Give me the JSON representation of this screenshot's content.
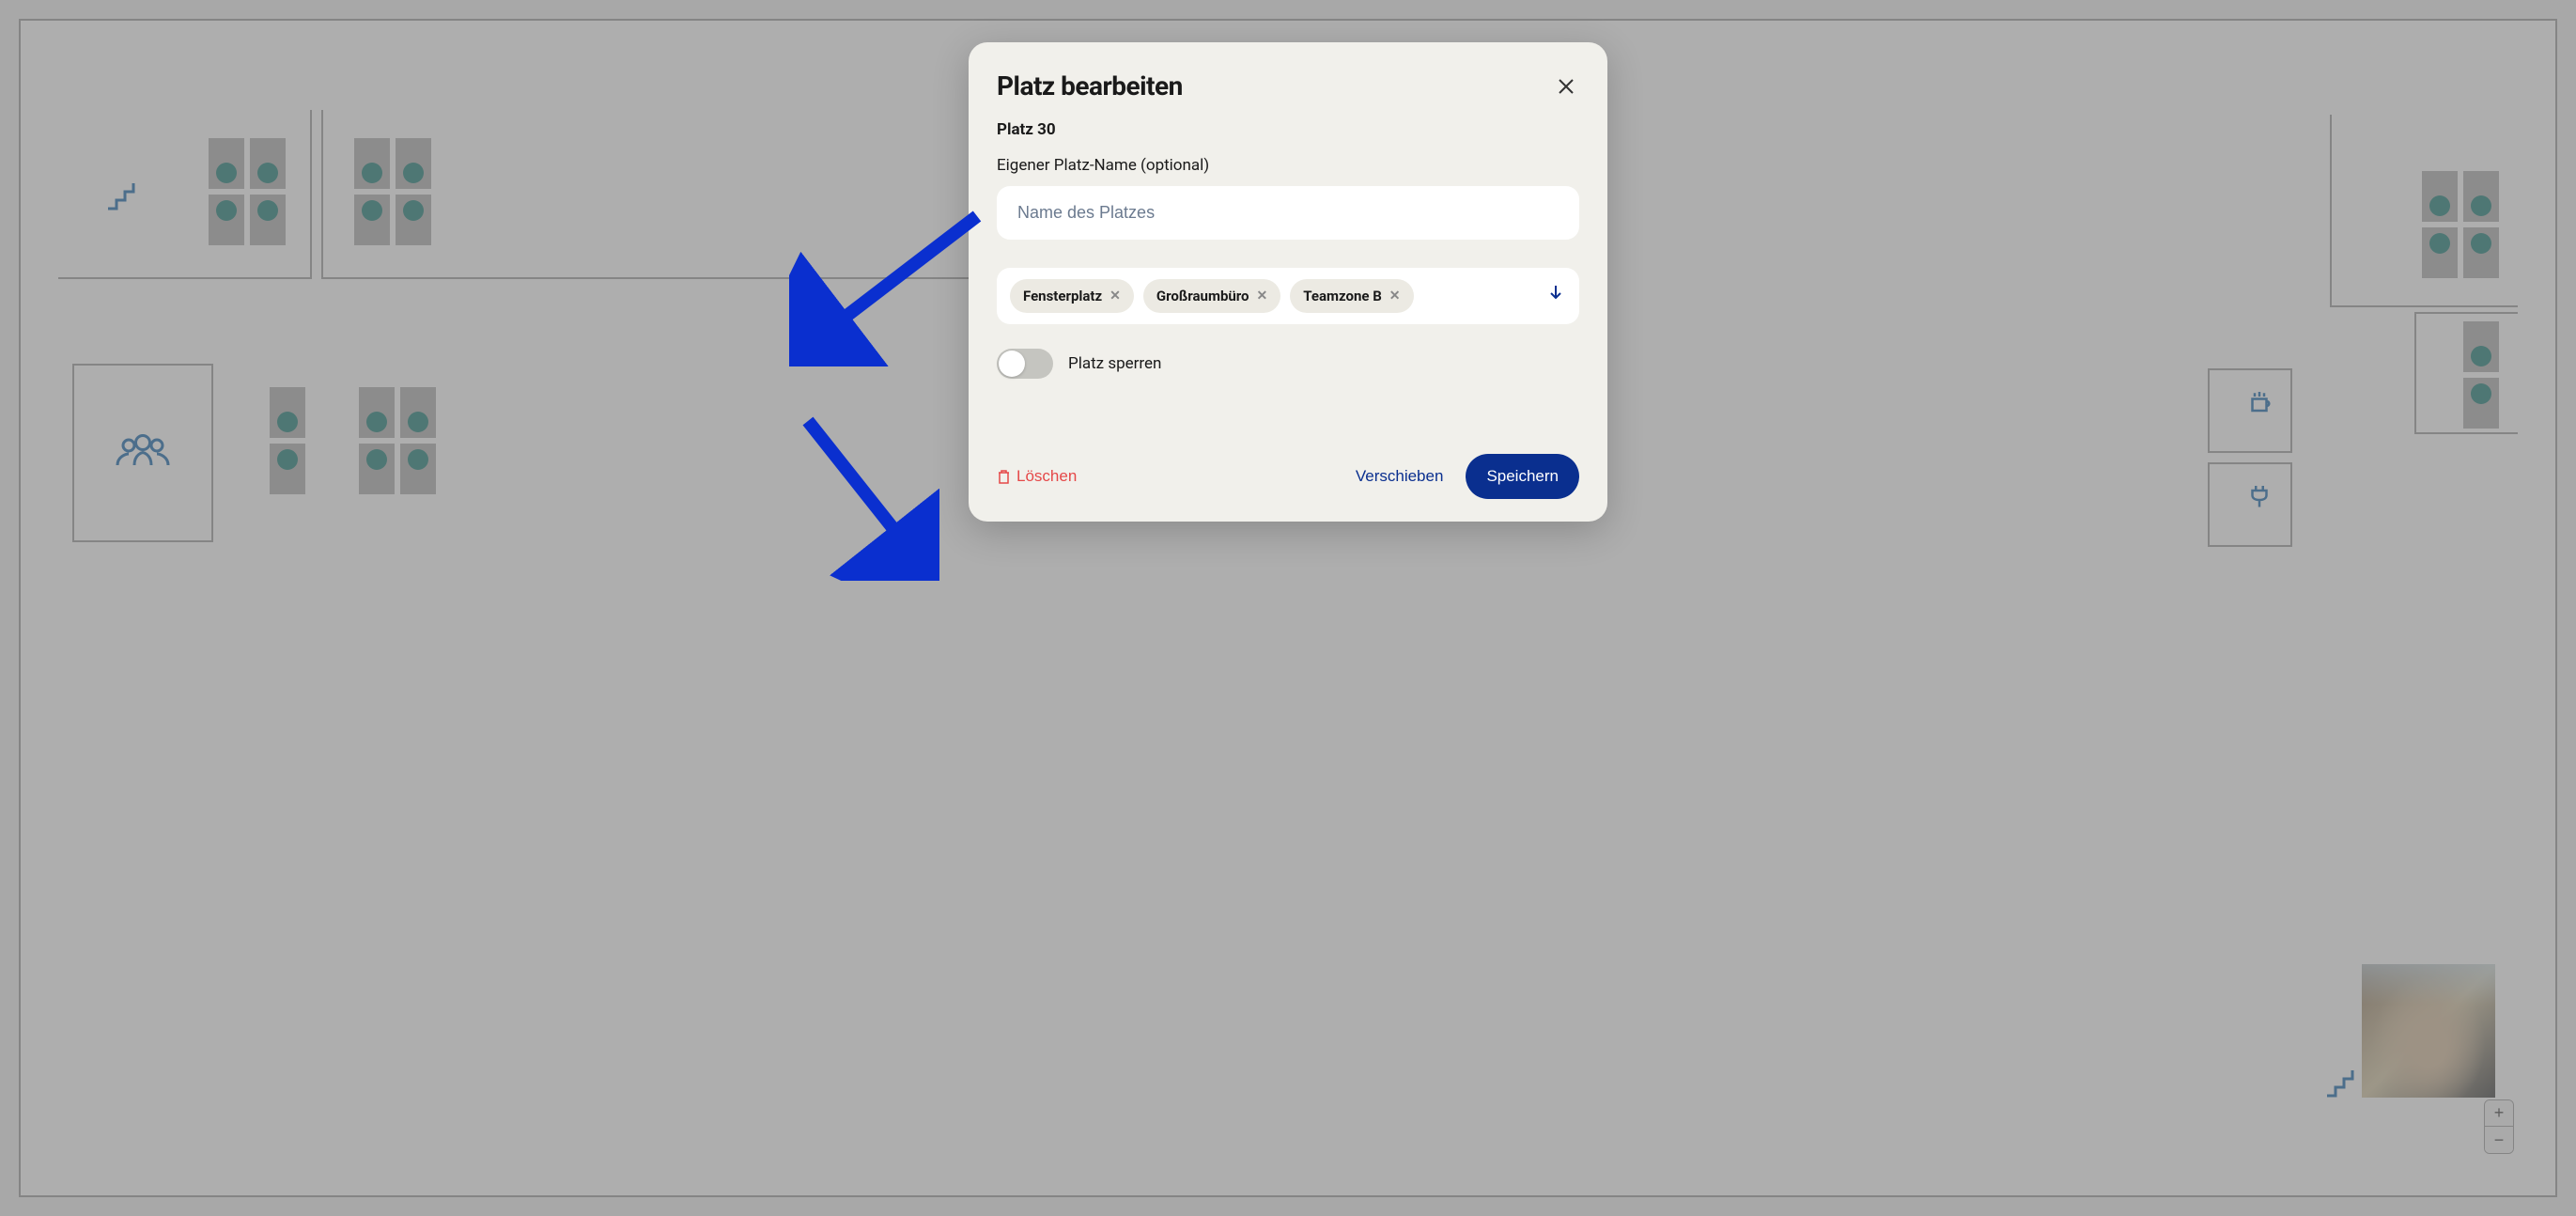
{
  "modal": {
    "title": "Platz bearbeiten",
    "subtitle": "Platz 30",
    "name_field": {
      "label": "Eigener Platz-Name (optional)",
      "placeholder": "Name des Platzes",
      "value": ""
    },
    "tags": [
      {
        "label": "Fensterplatz"
      },
      {
        "label": "Großraumbüro"
      },
      {
        "label": "Teamzone B"
      }
    ],
    "lock": {
      "label": "Platz sperren",
      "on": false
    },
    "actions": {
      "delete": "Löschen",
      "move": "Verschieben",
      "save": "Speichern"
    }
  },
  "zoom": {
    "in": "+",
    "out": "−"
  }
}
